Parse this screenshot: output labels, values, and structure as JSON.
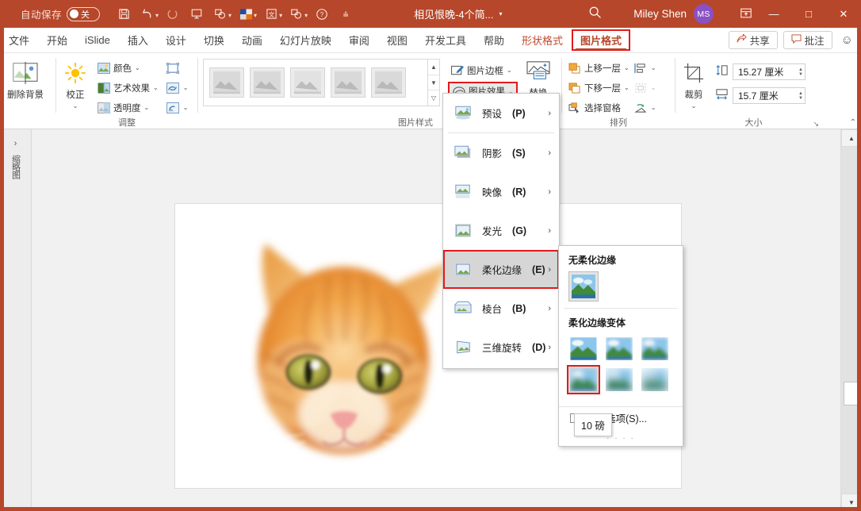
{
  "titlebar": {
    "autosave_label": "自动保存",
    "toggle_state": "关",
    "quick_access": [
      {
        "name": "save-icon",
        "glyph": "⎙"
      },
      {
        "name": "undo-icon",
        "glyph": "↶"
      },
      {
        "name": "redo-icon",
        "glyph": "↻"
      },
      {
        "name": "start-slideshow-icon",
        "glyph": "⬒"
      },
      {
        "name": "shapes-icon",
        "glyph": "⬡"
      },
      {
        "name": "color-blocks-icon",
        "glyph": "■"
      },
      {
        "name": "screenshot-icon",
        "glyph": "⌧"
      },
      {
        "name": "shape-union-icon",
        "glyph": "⬡"
      },
      {
        "name": "help-icon",
        "glyph": "ⓘ"
      },
      {
        "name": "customize-qat-icon",
        "glyph": "⌄"
      }
    ],
    "document_title": "相见恨晚-4个简...",
    "search_icon": "search-icon",
    "user_name": "Miley Shen",
    "user_initials": "MS",
    "ribbon_display_icon": "ribbon-display-options-icon",
    "minimize": "—",
    "maximize": "□",
    "close": "✕"
  },
  "tabs": [
    {
      "label": "文件",
      "state": "normal"
    },
    {
      "label": "开始",
      "state": "normal"
    },
    {
      "label": "iSlide",
      "state": "normal"
    },
    {
      "label": "插入",
      "state": "normal"
    },
    {
      "label": "设计",
      "state": "normal"
    },
    {
      "label": "切换",
      "state": "normal"
    },
    {
      "label": "动画",
      "state": "normal"
    },
    {
      "label": "幻灯片放映",
      "state": "normal"
    },
    {
      "label": "审阅",
      "state": "normal"
    },
    {
      "label": "视图",
      "state": "normal"
    },
    {
      "label": "开发工具",
      "state": "normal"
    },
    {
      "label": "帮助",
      "state": "normal"
    },
    {
      "label": "形状格式",
      "state": "contextual"
    },
    {
      "label": "图片格式",
      "state": "active-contextual-highlighted"
    }
  ],
  "tab_right": {
    "share_label": "共享",
    "share_icon": "share-icon",
    "comments_label": "批注",
    "comments_icon": "comment-icon",
    "feedback_icon": "smiley-icon"
  },
  "ribbon": {
    "groups": [
      {
        "name": "remove-background",
        "label": "",
        "buttons": [
          {
            "label": "删除背景",
            "icon": "remove-background-icon"
          }
        ]
      },
      {
        "name": "adjust",
        "label": "调整",
        "big": [
          {
            "label": "校正",
            "icon": "corrections-icon",
            "caret": "⌄"
          }
        ],
        "rows": [
          {
            "label": "颜色",
            "icon": "color-icon",
            "caret": "⌄"
          },
          {
            "label": "艺术效果",
            "icon": "artistic-effects-icon",
            "caret": "⌄"
          },
          {
            "label": "透明度",
            "icon": "transparency-icon",
            "caret": "⌄"
          }
        ],
        "icononly": [
          {
            "label": "",
            "icon": "compress-pictures-icon",
            "caret": ""
          },
          {
            "label": "",
            "icon": "change-picture-icon",
            "caret": "⌄"
          },
          {
            "label": "",
            "icon": "reset-picture-icon",
            "caret": "⌄"
          }
        ]
      },
      {
        "name": "picture-styles",
        "label": "图片样式",
        "gallery_items": 5,
        "scroll": [
          "▲",
          "▼",
          "▽"
        ],
        "rows": [
          {
            "label": "图片边框",
            "icon": "picture-border-icon",
            "caret": "⌄"
          },
          {
            "label": "图片效果",
            "icon": "picture-effects-icon",
            "caret": "⌄",
            "highlighted": true
          }
        ],
        "layout_button": {
          "label": "替换",
          "icon": "picture-layout-icon"
        }
      },
      {
        "name": "arrange",
        "label": "排列",
        "rows": [
          {
            "label": "上移一层",
            "icon": "bring-forward-icon",
            "caret": "⌄"
          },
          {
            "label": "下移一层",
            "icon": "send-backward-icon",
            "caret": "⌄"
          },
          {
            "label": "选择窗格",
            "icon": "selection-pane-icon",
            "caret": ""
          }
        ],
        "icononly": [
          {
            "label": "",
            "icon": "align-icon",
            "caret": "⌄"
          },
          {
            "label": "",
            "icon": "group-icon",
            "caret": "⌄"
          },
          {
            "label": "",
            "icon": "rotate-icon",
            "caret": "⌄"
          }
        ]
      },
      {
        "name": "size",
        "label": "大小",
        "big": [
          {
            "label": "裁剪",
            "icon": "crop-icon",
            "caret": "⌄"
          }
        ],
        "fields": [
          {
            "name": "height-field",
            "icon": "height-icon",
            "value": "15.27 厘米"
          },
          {
            "name": "width-field",
            "icon": "width-icon",
            "value": "15.7 厘米"
          }
        ],
        "dialog_launcher": "↘"
      }
    ]
  },
  "left_rail": {
    "chevron": "›",
    "label": "缩略图"
  },
  "slide": {
    "image_alt": "橙色猫头照片"
  },
  "picture_effects_menu": {
    "items": [
      {
        "label": "预设",
        "accel": "P",
        "icon": "preset-effects-icon",
        "arrow": "›",
        "selected": false
      },
      {
        "label": "阴影",
        "accel": "S",
        "icon": "shadow-icon",
        "arrow": "›",
        "selected": false
      },
      {
        "label": "映像",
        "accel": "R",
        "icon": "reflection-icon",
        "arrow": "›",
        "selected": false
      },
      {
        "label": "发光",
        "accel": "G",
        "icon": "glow-icon",
        "arrow": "›",
        "selected": false
      },
      {
        "label": "柔化边缘",
        "accel": "E",
        "icon": "soft-edges-icon",
        "arrow": "›",
        "selected": true
      },
      {
        "label": "棱台",
        "accel": "B",
        "icon": "bevel-icon",
        "arrow": "›",
        "selected": false
      },
      {
        "label": "三维旋转",
        "accel": "D",
        "icon": "3d-rotation-icon",
        "arrow": "›",
        "selected": false
      }
    ]
  },
  "soft_edges_submenu": {
    "heading_none": "无柔化边缘",
    "heading_variants": "柔化边缘变体",
    "variants": [
      {
        "name": "soft-edge-1pt",
        "blur": 1,
        "selected": false
      },
      {
        "name": "soft-edge-2.5pt",
        "blur": 2,
        "selected": false
      },
      {
        "name": "soft-edge-5pt",
        "blur": 3,
        "selected": false
      },
      {
        "name": "soft-edge-10pt",
        "blur": 4,
        "selected": true
      },
      {
        "name": "soft-edge-25pt",
        "blur": 6,
        "selected": false
      },
      {
        "name": "soft-edge-50pt",
        "blur": 8,
        "selected": false
      }
    ],
    "options_label": "边缘选项(S)...",
    "grip": "· · · ·"
  },
  "tooltip": {
    "text": "10 磅"
  },
  "colors": {
    "titlebar": "#b7472a",
    "accent_red": "#e01b1b",
    "contextual_tab": "#c0492b",
    "avatar": "#8a51c4",
    "workarea": "#f1f1f1"
  }
}
